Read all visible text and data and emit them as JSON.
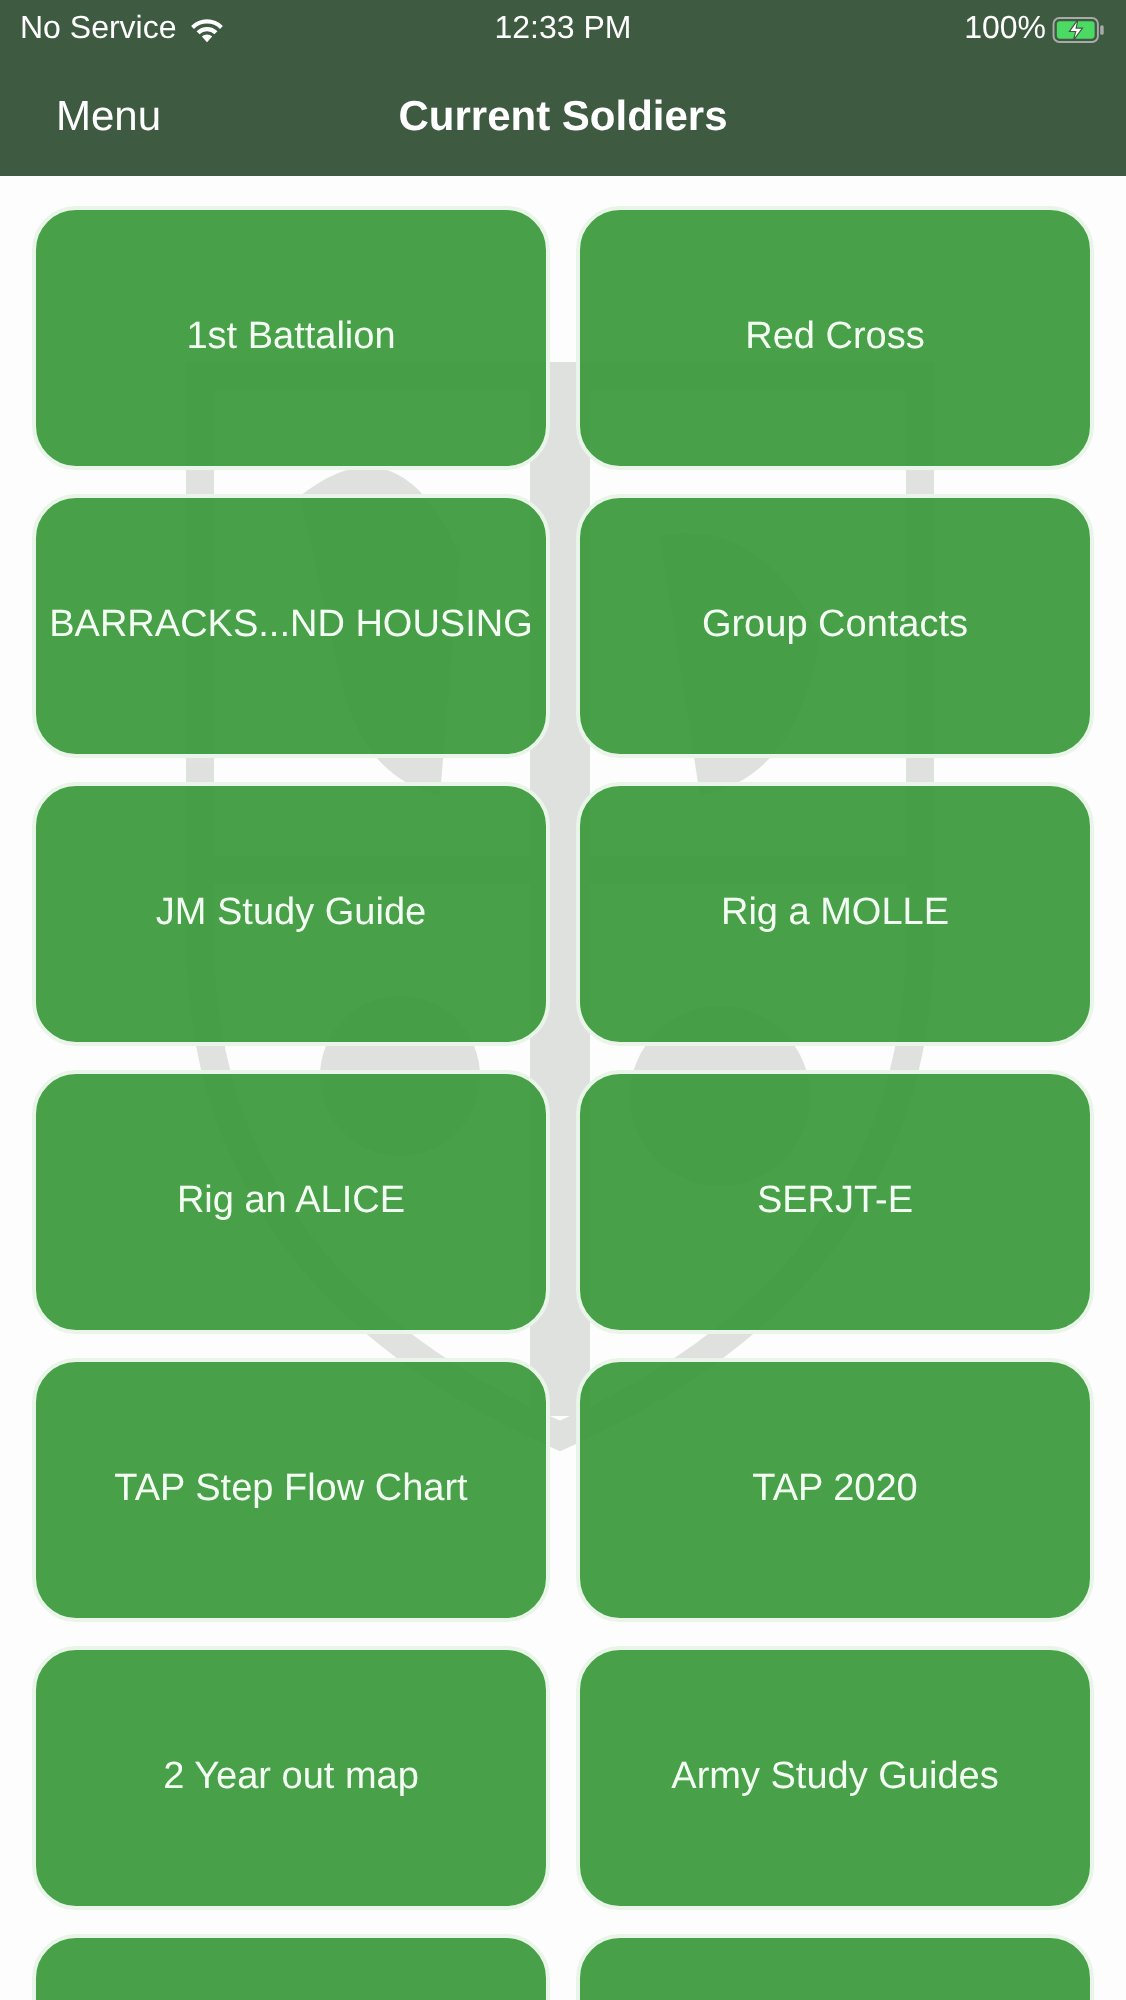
{
  "status_bar": {
    "carrier": "No Service",
    "time": "12:33 PM",
    "battery": "100%",
    "charging": true
  },
  "nav_bar": {
    "left_button": "Menu",
    "title": "Current Soldiers"
  },
  "tiles": [
    {
      "label": "1st Battalion"
    },
    {
      "label": "Red Cross"
    },
    {
      "label": "BARRACKS...ND HOUSING"
    },
    {
      "label": "Group Contacts"
    },
    {
      "label": "JM Study Guide"
    },
    {
      "label": "Rig a MOLLE"
    },
    {
      "label": "Rig an ALICE"
    },
    {
      "label": "SERJT-E"
    },
    {
      "label": "TAP Step Flow Chart"
    },
    {
      "label": "TAP 2020"
    },
    {
      "label": "2 Year out map"
    },
    {
      "label": "Army Study Guides"
    }
  ],
  "more_tiles_below": true
}
